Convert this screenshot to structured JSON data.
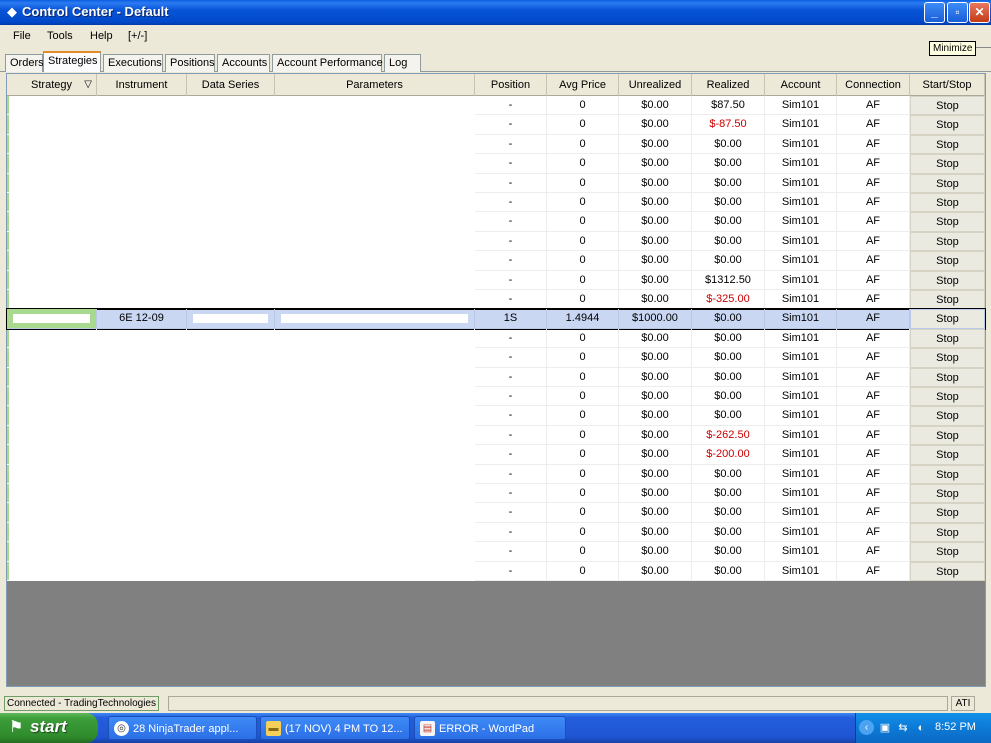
{
  "window": {
    "title": "Control Center - Default",
    "controls": {
      "minimize": "_",
      "maximize": "▫",
      "close": "✕"
    },
    "tooltip": "Minimize"
  },
  "menu": [
    "File",
    "Tools",
    "Help",
    "[+/-]"
  ],
  "tabs": [
    "Orders",
    "Strategies",
    "Executions",
    "Positions",
    "Accounts",
    "Account Performance",
    "Log"
  ],
  "active_tab": "Strategies",
  "columns": [
    "Strategy",
    "Instrument",
    "Data Series",
    "Parameters",
    "Position",
    "Avg Price",
    "Unrealized",
    "Realized",
    "Account",
    "Connection",
    "Start/Stop"
  ],
  "sort_indicator": "▽",
  "rows": [
    {
      "position": "-",
      "avg": "0",
      "unrealized": "$0.00",
      "realized": "$87.50",
      "account": "Sim101",
      "conn": "AF",
      "action": "Stop",
      "neg": false
    },
    {
      "position": "-",
      "avg": "0",
      "unrealized": "$0.00",
      "realized": "$-87.50",
      "account": "Sim101",
      "conn": "AF",
      "action": "Stop",
      "neg": true
    },
    {
      "position": "-",
      "avg": "0",
      "unrealized": "$0.00",
      "realized": "$0.00",
      "account": "Sim101",
      "conn": "AF",
      "action": "Stop",
      "neg": false
    },
    {
      "position": "-",
      "avg": "0",
      "unrealized": "$0.00",
      "realized": "$0.00",
      "account": "Sim101",
      "conn": "AF",
      "action": "Stop",
      "neg": false
    },
    {
      "position": "-",
      "avg": "0",
      "unrealized": "$0.00",
      "realized": "$0.00",
      "account": "Sim101",
      "conn": "AF",
      "action": "Stop",
      "neg": false
    },
    {
      "position": "-",
      "avg": "0",
      "unrealized": "$0.00",
      "realized": "$0.00",
      "account": "Sim101",
      "conn": "AF",
      "action": "Stop",
      "neg": false
    },
    {
      "position": "-",
      "avg": "0",
      "unrealized": "$0.00",
      "realized": "$0.00",
      "account": "Sim101",
      "conn": "AF",
      "action": "Stop",
      "neg": false
    },
    {
      "position": "-",
      "avg": "0",
      "unrealized": "$0.00",
      "realized": "$0.00",
      "account": "Sim101",
      "conn": "AF",
      "action": "Stop",
      "neg": false
    },
    {
      "position": "-",
      "avg": "0",
      "unrealized": "$0.00",
      "realized": "$0.00",
      "account": "Sim101",
      "conn": "AF",
      "action": "Stop",
      "neg": false
    },
    {
      "position": "-",
      "avg": "0",
      "unrealized": "$0.00",
      "realized": "$1312.50",
      "account": "Sim101",
      "conn": "AF",
      "action": "Stop",
      "neg": false
    },
    {
      "position": "-",
      "avg": "0",
      "unrealized": "$0.00",
      "realized": "$-325.00",
      "account": "Sim101",
      "conn": "AF",
      "action": "Stop",
      "neg": true
    },
    {
      "position": "1S",
      "avg": "1.4944",
      "unrealized": "$1000.00",
      "realized": "$0.00",
      "account": "Sim101",
      "conn": "AF",
      "action": "Stop",
      "neg": false,
      "instrument": "6E 12-09",
      "selected": true
    },
    {
      "position": "-",
      "avg": "0",
      "unrealized": "$0.00",
      "realized": "$0.00",
      "account": "Sim101",
      "conn": "AF",
      "action": "Stop",
      "neg": false
    },
    {
      "position": "-",
      "avg": "0",
      "unrealized": "$0.00",
      "realized": "$0.00",
      "account": "Sim101",
      "conn": "AF",
      "action": "Stop",
      "neg": false
    },
    {
      "position": "-",
      "avg": "0",
      "unrealized": "$0.00",
      "realized": "$0.00",
      "account": "Sim101",
      "conn": "AF",
      "action": "Stop",
      "neg": false
    },
    {
      "position": "-",
      "avg": "0",
      "unrealized": "$0.00",
      "realized": "$0.00",
      "account": "Sim101",
      "conn": "AF",
      "action": "Stop",
      "neg": false
    },
    {
      "position": "-",
      "avg": "0",
      "unrealized": "$0.00",
      "realized": "$0.00",
      "account": "Sim101",
      "conn": "AF",
      "action": "Stop",
      "neg": false
    },
    {
      "position": "-",
      "avg": "0",
      "unrealized": "$0.00",
      "realized": "$-262.50",
      "account": "Sim101",
      "conn": "AF",
      "action": "Stop",
      "neg": true
    },
    {
      "position": "-",
      "avg": "0",
      "unrealized": "$0.00",
      "realized": "$-200.00",
      "account": "Sim101",
      "conn": "AF",
      "action": "Stop",
      "neg": true
    },
    {
      "position": "-",
      "avg": "0",
      "unrealized": "$0.00",
      "realized": "$0.00",
      "account": "Sim101",
      "conn": "AF",
      "action": "Stop",
      "neg": false
    },
    {
      "position": "-",
      "avg": "0",
      "unrealized": "$0.00",
      "realized": "$0.00",
      "account": "Sim101",
      "conn": "AF",
      "action": "Stop",
      "neg": false
    },
    {
      "position": "-",
      "avg": "0",
      "unrealized": "$0.00",
      "realized": "$0.00",
      "account": "Sim101",
      "conn": "AF",
      "action": "Stop",
      "neg": false
    },
    {
      "position": "-",
      "avg": "0",
      "unrealized": "$0.00",
      "realized": "$0.00",
      "account": "Sim101",
      "conn": "AF",
      "action": "Stop",
      "neg": false
    },
    {
      "position": "-",
      "avg": "0",
      "unrealized": "$0.00",
      "realized": "$0.00",
      "account": "Sim101",
      "conn": "AF",
      "action": "Stop",
      "neg": false
    },
    {
      "position": "-",
      "avg": "0",
      "unrealized": "$0.00",
      "realized": "$0.00",
      "account": "Sim101",
      "conn": "AF",
      "action": "Stop",
      "neg": false
    }
  ],
  "status": {
    "connection": "Connected - TradingTechnologies",
    "right": "ATI"
  },
  "taskbar": {
    "start": "start",
    "tasks": [
      {
        "label": "28 NinjaTrader appl...",
        "icon": "ninjatrader-icon"
      },
      {
        "label": "(17 NOV) 4 PM TO 12...",
        "icon": "folder-icon"
      },
      {
        "label": "ERROR - WordPad",
        "icon": "wordpad-icon"
      }
    ],
    "clock": "8:52 PM"
  },
  "colors": {
    "negative": "#CC0000",
    "selected_row": "#C9D7F3",
    "titlebar": "#0854D8",
    "start": "#3C9D39"
  }
}
